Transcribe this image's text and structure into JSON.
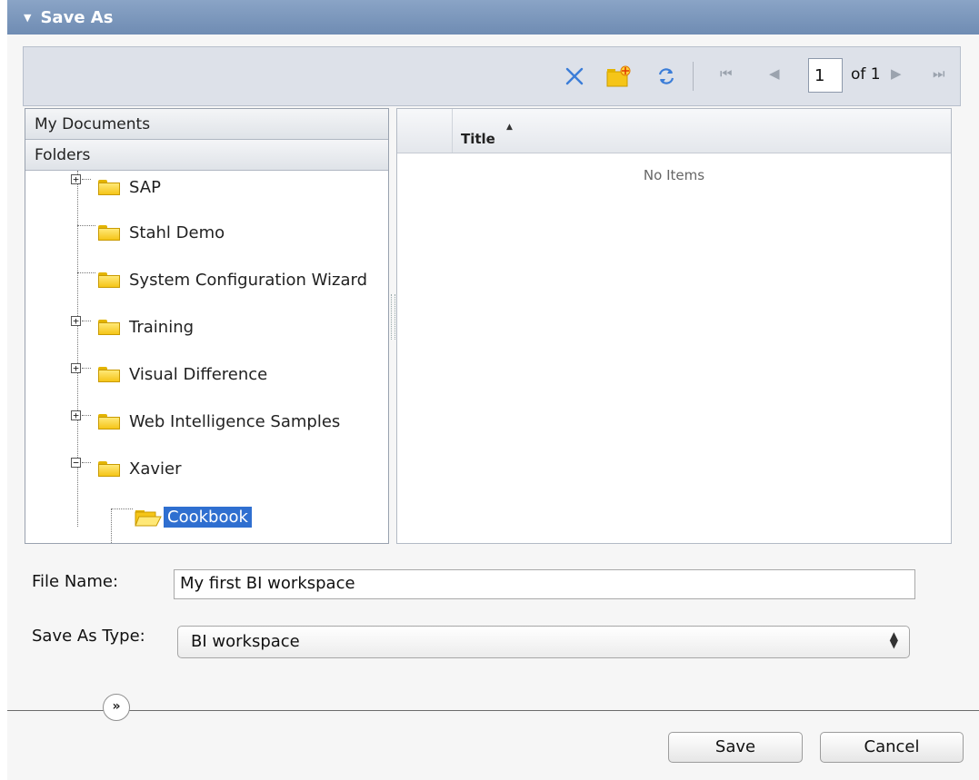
{
  "dialog": {
    "title": "Save As"
  },
  "toolbar": {
    "icons": [
      "delete-icon",
      "new-folder-icon",
      "refresh-icon"
    ],
    "page_value": "1",
    "page_of": "of 1"
  },
  "tree": {
    "my_documents": "My Documents",
    "folders": "Folders",
    "items": [
      {
        "label": "SAP",
        "expander": "+"
      },
      {
        "label": "Stahl Demo",
        "expander": ""
      },
      {
        "label": "System Configuration Wizard",
        "expander": ""
      },
      {
        "label": "Training",
        "expander": "+"
      },
      {
        "label": "Visual Difference",
        "expander": "+"
      },
      {
        "label": "Web Intelligence Samples",
        "expander": "+"
      },
      {
        "label": "Xavier",
        "expander": "−"
      },
      {
        "label": "Cookbook",
        "expander": "",
        "selected": true
      }
    ]
  },
  "list": {
    "column_title": "Title",
    "empty_text": "No Items"
  },
  "form": {
    "file_name_label": "File Name:",
    "file_name_value": "My first BI workspace",
    "save_as_type_label": "Save As Type:",
    "save_as_type_value": "BI workspace"
  },
  "buttons": {
    "expand": "»",
    "save": "Save",
    "cancel": "Cancel"
  },
  "colors": {
    "title_bar": "#7793ba",
    "selection": "#2f6fd0",
    "delete_icon": "#3b7dd8"
  }
}
